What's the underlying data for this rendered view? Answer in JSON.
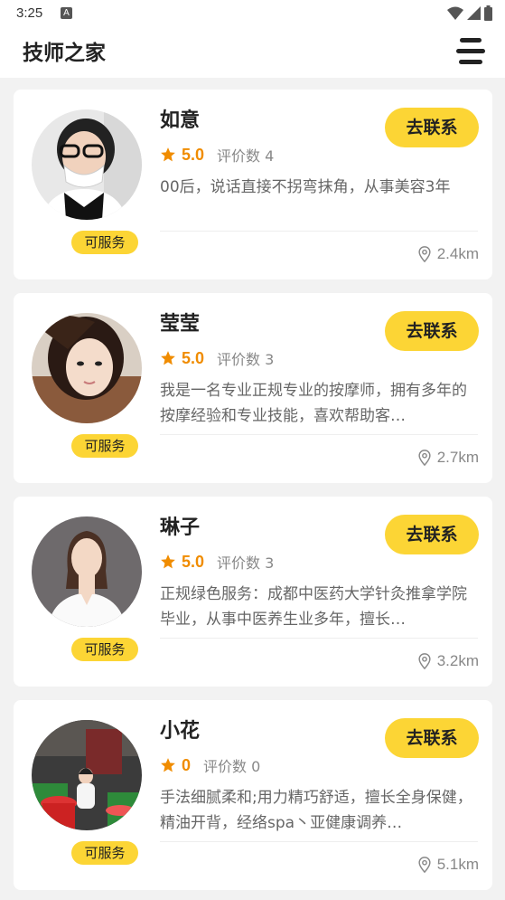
{
  "status_bar": {
    "time": "3:25",
    "notification_letter": "A"
  },
  "header": {
    "title": "技师之家"
  },
  "technicians": [
    {
      "name": "如意",
      "status": "可服务",
      "contact_label": "去联系",
      "rating": "5.0",
      "reviews": "评价数 4",
      "description": "00后，说话直接不拐弯抹角，从事美容3年",
      "distance": "2.4km"
    },
    {
      "name": "莹莹",
      "status": "可服务",
      "contact_label": "去联系",
      "rating": "5.0",
      "reviews": "评价数 3",
      "description": "我是一名专业正规专业的按摩师，拥有多年的按摩经验和专业技能，喜欢帮助客…",
      "distance": "2.7km"
    },
    {
      "name": "琳子",
      "status": "可服务",
      "contact_label": "去联系",
      "rating": "5.0",
      "reviews": "评价数 3",
      "description": "正规绿色服务：成都中医药大学针灸推拿学院毕业，从事中医养生业多年，擅长…",
      "distance": "3.2km"
    },
    {
      "name": "小花",
      "status": "可服务",
      "contact_label": "去联系",
      "rating": "0",
      "reviews": "评价数 0",
      "description": "手法细腻柔和;用力精巧舒适，擅长全身保健，精油开背，经络spa丶亚健康调养…",
      "distance": "5.1km"
    }
  ],
  "colors": {
    "accent": "#fcd535",
    "star": "#f08c00"
  }
}
